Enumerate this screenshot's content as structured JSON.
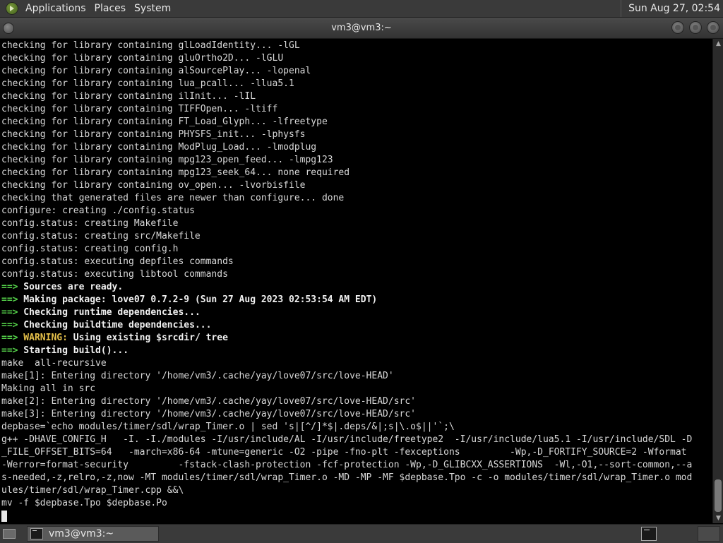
{
  "top_panel": {
    "menus": [
      "Applications",
      "Places",
      "System"
    ],
    "clock": "Sun Aug 27, 02:54"
  },
  "window": {
    "title": "vm3@vm3:~"
  },
  "terminal": {
    "lines": [
      [
        {
          "t": "checking for library containing glLoadIdentity... -lGL"
        }
      ],
      [
        {
          "t": "checking for library containing gluOrtho2D... -lGLU"
        }
      ],
      [
        {
          "t": "checking for library containing alSourcePlay... -lopenal"
        }
      ],
      [
        {
          "t": "checking for library containing lua_pcall... -llua5.1"
        }
      ],
      [
        {
          "t": "checking for library containing ilInit... -lIL"
        }
      ],
      [
        {
          "t": "checking for library containing TIFFOpen... -ltiff"
        }
      ],
      [
        {
          "t": "checking for library containing FT_Load_Glyph... -lfreetype"
        }
      ],
      [
        {
          "t": "checking for library containing PHYSFS_init... -lphysfs"
        }
      ],
      [
        {
          "t": "checking for library containing ModPlug_Load... -lmodplug"
        }
      ],
      [
        {
          "t": "checking for library containing mpg123_open_feed... -lmpg123"
        }
      ],
      [
        {
          "t": "checking for library containing mpg123_seek_64... none required"
        }
      ],
      [
        {
          "t": "checking for library containing ov_open... -lvorbisfile"
        }
      ],
      [
        {
          "t": "checking that generated files are newer than configure... done"
        }
      ],
      [
        {
          "t": "configure: creating ./config.status"
        }
      ],
      [
        {
          "t": "config.status: creating Makefile"
        }
      ],
      [
        {
          "t": "config.status: creating src/Makefile"
        }
      ],
      [
        {
          "t": "config.status: creating config.h"
        }
      ],
      [
        {
          "t": "config.status: executing depfiles commands"
        }
      ],
      [
        {
          "t": "config.status: executing libtool commands"
        }
      ],
      [
        {
          "t": "==>",
          "c": "arrow"
        },
        {
          "t": " Sources are ready.",
          "c": "bold"
        }
      ],
      [
        {
          "t": "==>",
          "c": "arrow"
        },
        {
          "t": " Making package: love07 0.7.2-9 (Sun 27 Aug 2023 02:53:54 AM EDT)",
          "c": "bold"
        }
      ],
      [
        {
          "t": "==>",
          "c": "arrow"
        },
        {
          "t": " Checking runtime dependencies...",
          "c": "bold"
        }
      ],
      [
        {
          "t": "==>",
          "c": "arrow"
        },
        {
          "t": " Checking buildtime dependencies...",
          "c": "bold"
        }
      ],
      [
        {
          "t": "==>",
          "c": "arrow"
        },
        {
          "t": " WARNING:",
          "c": "warn"
        },
        {
          "t": " Using existing $srcdir/ tree",
          "c": "bold"
        }
      ],
      [
        {
          "t": "==>",
          "c": "arrow"
        },
        {
          "t": " Starting build()...",
          "c": "bold"
        }
      ],
      [
        {
          "t": "make  all-recursive"
        }
      ],
      [
        {
          "t": "make[1]: Entering directory '/home/vm3/.cache/yay/love07/src/love-HEAD'"
        }
      ],
      [
        {
          "t": "Making all in src"
        }
      ],
      [
        {
          "t": "make[2]: Entering directory '/home/vm3/.cache/yay/love07/src/love-HEAD/src'"
        }
      ],
      [
        {
          "t": "make[3]: Entering directory '/home/vm3/.cache/yay/love07/src/love-HEAD/src'"
        }
      ],
      [
        {
          "t": "depbase=`echo modules/timer/sdl/wrap_Timer.o | sed 's|[^/]*$|.deps/&|;s|\\.o$||'`;\\"
        }
      ],
      [
        {
          "t": "g++ -DHAVE_CONFIG_H   -I. -I./modules -I/usr/include/AL -I/usr/include/freetype2  -I/usr/include/lua5.1 -I/usr/include/SDL -D"
        }
      ],
      [
        {
          "t": "_FILE_OFFSET_BITS=64   -march=x86-64 -mtune=generic -O2 -pipe -fno-plt -fexceptions         -Wp,-D_FORTIFY_SOURCE=2 -Wformat"
        }
      ],
      [
        {
          "t": "-Werror=format-security         -fstack-clash-protection -fcf-protection -Wp,-D_GLIBCXX_ASSERTIONS  -Wl,-O1,--sort-common,--a"
        }
      ],
      [
        {
          "t": "s-needed,-z,relro,-z,now -MT modules/timer/sdl/wrap_Timer.o -MD -MP -MF $depbase.Tpo -c -o modules/timer/sdl/wrap_Timer.o mod"
        }
      ],
      [
        {
          "t": "ules/timer/sdl/wrap_Timer.cpp &&\\"
        }
      ],
      [
        {
          "t": "mv -f $depbase.Tpo $depbase.Po"
        }
      ]
    ]
  },
  "taskbar": {
    "task_label": "vm3@vm3:~"
  },
  "icons": {
    "logo": "gnome-foot-icon",
    "window_menu": "window-menu-icon",
    "minimize": "minimize-icon",
    "maximize": "maximize-icon",
    "close": "close-icon",
    "show_desktop": "show-desktop-icon",
    "terminal": "terminal-icon"
  }
}
